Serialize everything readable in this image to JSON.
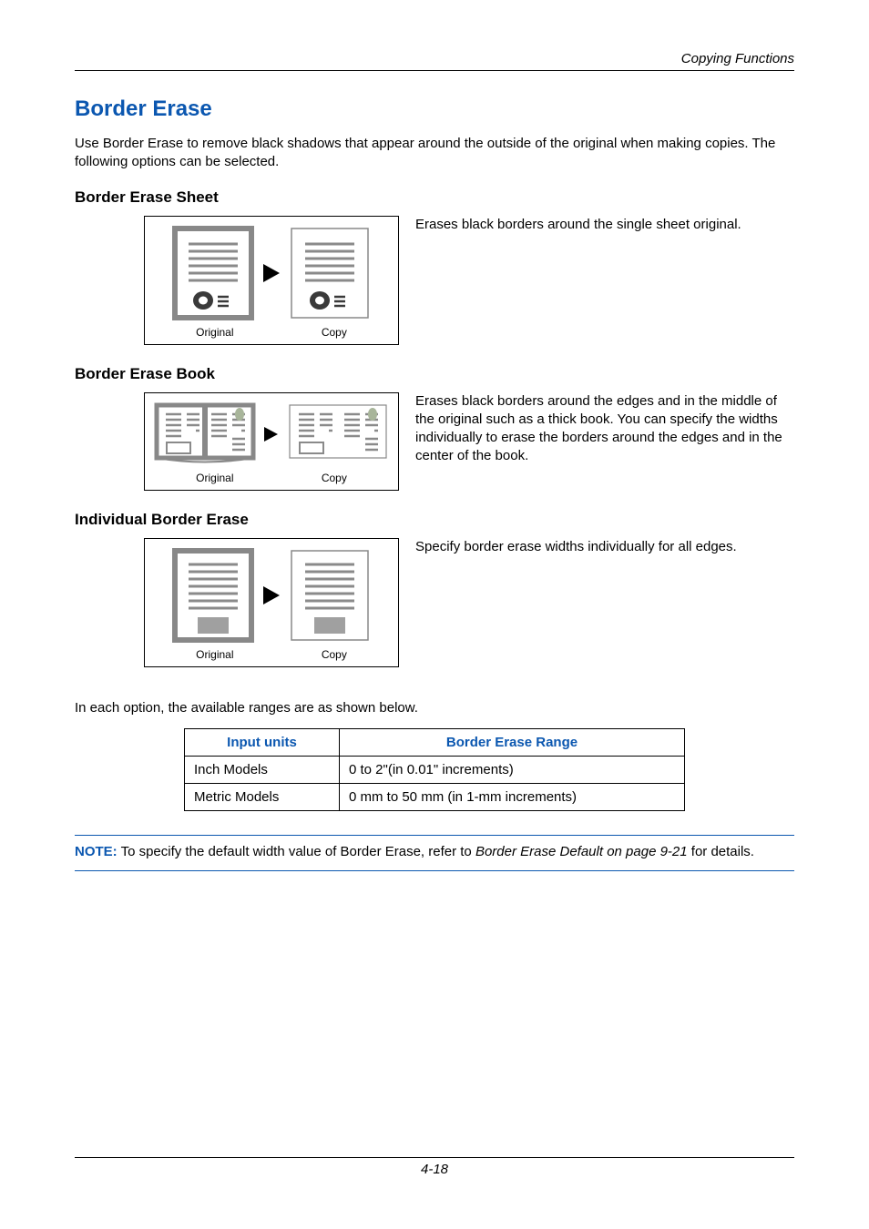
{
  "header": {
    "section": "Copying Functions"
  },
  "title": "Border Erase",
  "intro": "Use Border Erase to remove black shadows that appear around the outside of the original when making copies. The following options can be selected.",
  "sections": {
    "sheet": {
      "heading": "Border Erase Sheet",
      "desc": "Erases black borders around the single sheet original.",
      "original_label": "Original",
      "copy_label": "Copy"
    },
    "book": {
      "heading": "Border Erase Book",
      "desc": "Erases black borders around the edges and in the middle of the original such as a thick book. You can specify the widths individually to erase the borders around the edges and in the center of the book.",
      "original_label": "Original",
      "copy_label": "Copy"
    },
    "individual": {
      "heading": "Individual Border Erase",
      "desc": "Specify border erase widths individually for all edges.",
      "original_label": "Original",
      "copy_label": "Copy"
    }
  },
  "ranges_intro": "In each option, the available ranges are as shown below.",
  "table": {
    "col_units": "Input units",
    "col_range": "Border Erase Range",
    "rows": [
      {
        "units": "Inch Models",
        "range": "0 to 2\"(in 0.01\" increments)"
      },
      {
        "units": "Metric Models",
        "range": "0 mm to 50 mm (in 1-mm increments)"
      }
    ]
  },
  "note": {
    "label": "NOTE:",
    "pre": " To specify the default width value of Border Erase, refer to ",
    "link": "Border Erase Default on page 9-21",
    "post": " for details."
  },
  "page_number": "4-18"
}
